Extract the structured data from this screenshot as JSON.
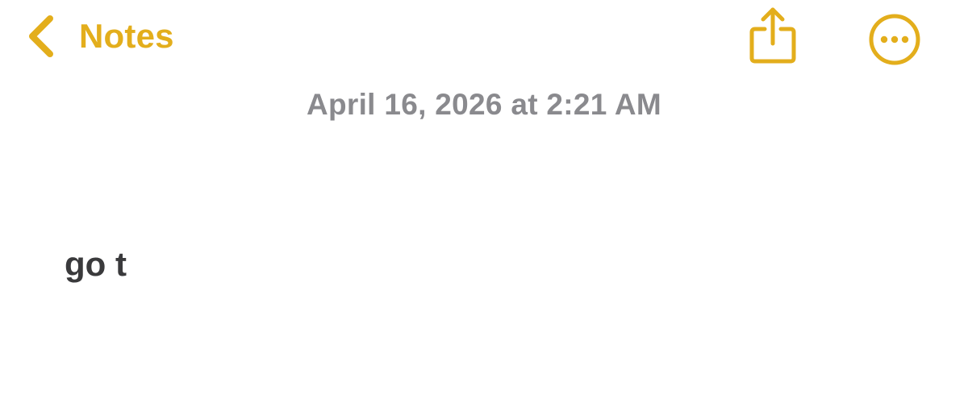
{
  "nav": {
    "back_label": "Notes",
    "back_icon": "chevron-left-icon",
    "share_icon": "share-icon",
    "more_icon": "ellipsis-circle-icon"
  },
  "note": {
    "date": "April 16, 2026 at 2:21 AM",
    "body": "go t"
  },
  "colors": {
    "accent": "#E3AE1C",
    "date_text": "#8A8A8E",
    "body_text": "#3A3A3C",
    "background": "#FFFFFF"
  }
}
